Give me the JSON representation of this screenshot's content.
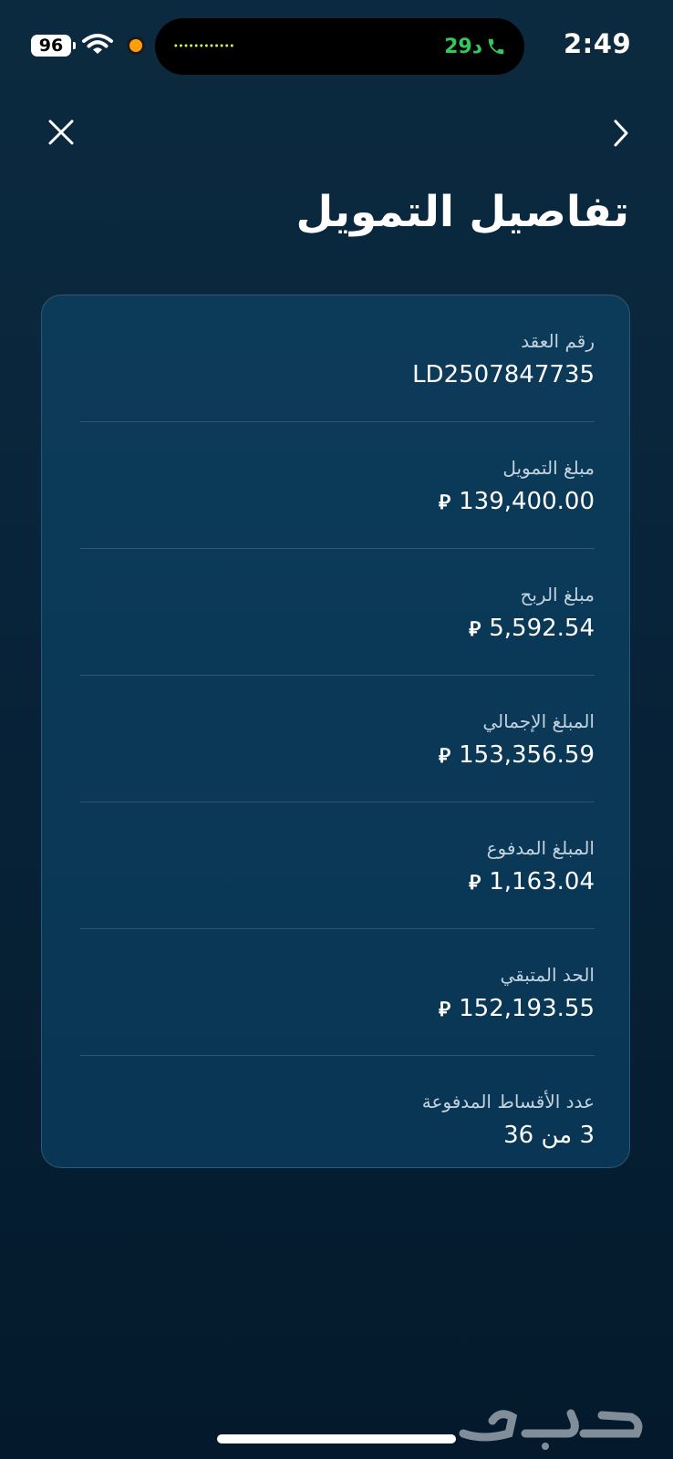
{
  "status_bar": {
    "battery": "96",
    "call_timer": "29د",
    "time": "2:49"
  },
  "header": {
    "title": "تفاصيل التمويل"
  },
  "details": [
    {
      "label": "رقم العقد",
      "value": "LD2507847735",
      "currency": ""
    },
    {
      "label": "مبلغ التمويل",
      "value": "139,400.00",
      "currency": "⃁"
    },
    {
      "label": "مبلغ الربح",
      "value": "5,592.54",
      "currency": "⃁"
    },
    {
      "label": "المبلغ الإجمالي",
      "value": "153,356.59",
      "currency": "⃁"
    },
    {
      "label": "المبلغ المدفوع",
      "value": "1,163.04",
      "currency": "⃁"
    },
    {
      "label": "الحد المتبقي",
      "value": "152,193.55",
      "currency": "⃁"
    },
    {
      "label": "عدد الأقساط المدفوعة",
      "value": "3 من 36",
      "currency": ""
    }
  ],
  "watermark": "حراج",
  "icons": {
    "close": "close-icon",
    "forward": "chevron-right-icon",
    "wifi": "wifi-icon",
    "call": "phone-icon"
  },
  "colors": {
    "call_green": "#34c759",
    "recording_dot": "#ff9f0a",
    "card_border": "#2e5877"
  }
}
